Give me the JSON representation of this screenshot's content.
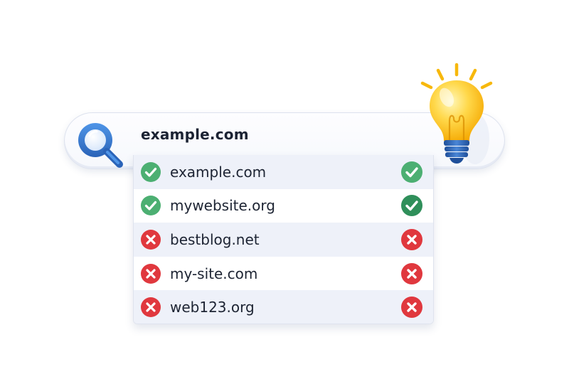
{
  "search": {
    "query": "example.com"
  },
  "results": [
    {
      "domain": "example.com",
      "available": true
    },
    {
      "domain": "mywebsite.org",
      "available": true
    },
    {
      "domain": "bestblog.net",
      "available": false
    },
    {
      "domain": "my-site.com",
      "available": false
    },
    {
      "domain": "web123.org",
      "available": false
    }
  ],
  "icons": {
    "search": "magnifier-icon",
    "available": "check-circle-icon",
    "unavailable": "x-circle-icon",
    "idea": "lightbulb-icon"
  },
  "colors": {
    "available": "#4caf72",
    "unavailable": "#e0383e",
    "search_icon": "#3a7bd5",
    "bulb": "#ffc21a"
  }
}
